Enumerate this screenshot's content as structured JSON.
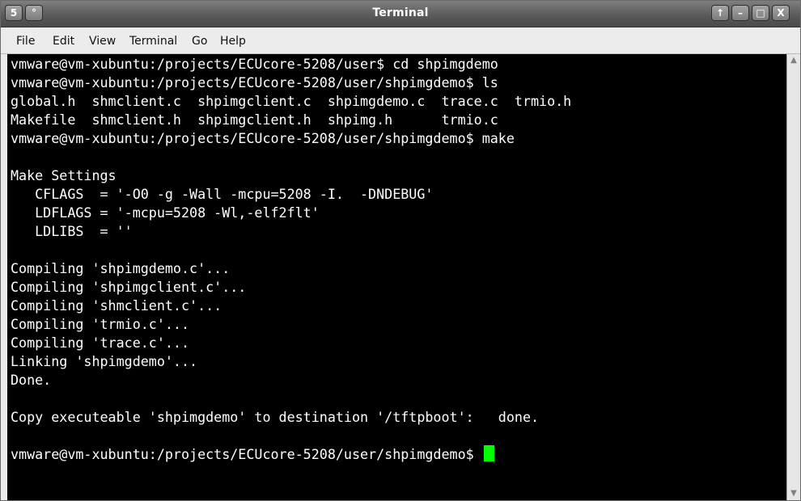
{
  "window": {
    "title": "Terminal",
    "buttons": {
      "menu": "5",
      "sticky": "°",
      "up": "↑",
      "minimize": "–",
      "maximize": "□",
      "close": "X"
    }
  },
  "menubar": {
    "file": "File",
    "edit": "Edit",
    "view": "View",
    "terminal": "Terminal",
    "go": "Go",
    "help": "Help"
  },
  "terminal": {
    "cursor_color": "#00ff00",
    "lines": [
      "vmware@vm-xubuntu:/projects/ECUcore-5208/user$ cd shpimgdemo",
      "vmware@vm-xubuntu:/projects/ECUcore-5208/user/shpimgdemo$ ls",
      "global.h  shmclient.c  shpimgclient.c  shpimgdemo.c  trace.c  trmio.h",
      "Makefile  shmclient.h  shpimgclient.h  shpimg.h      trmio.c",
      "vmware@vm-xubuntu:/projects/ECUcore-5208/user/shpimgdemo$ make",
      "",
      "Make Settings",
      "   CFLAGS  = '-O0 -g -Wall -mcpu=5208 -I.  -DNDEBUG'",
      "   LDFLAGS = '-mcpu=5208 -Wl,-elf2flt'",
      "   LDLIBS  = ''",
      "",
      "Compiling 'shpimgdemo.c'...",
      "Compiling 'shpimgclient.c'...",
      "Compiling 'shmclient.c'...",
      "Compiling 'trmio.c'...",
      "Compiling 'trace.c'...",
      "Linking 'shpimgdemo'...",
      "Done.",
      "",
      "Copy executeable 'shpimgdemo' to destination '/tftpboot':   done.",
      "",
      "vmware@vm-xubuntu:/projects/ECUcore-5208/user/shpimgdemo$ "
    ]
  }
}
